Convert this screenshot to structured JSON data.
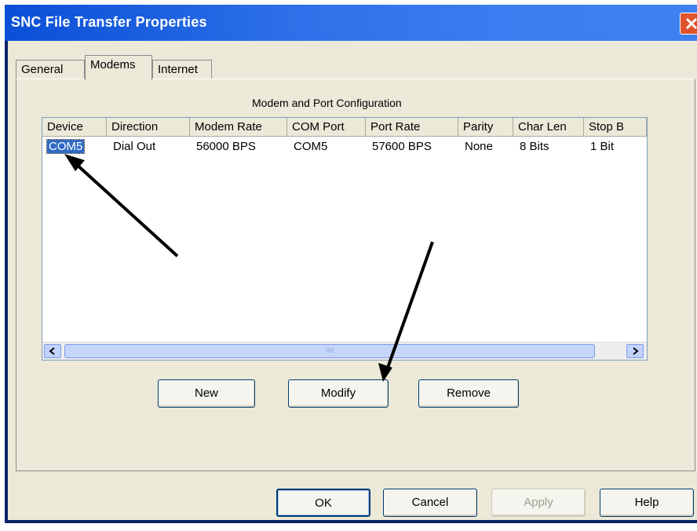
{
  "window": {
    "title": "SNC File Transfer Properties"
  },
  "tabs": [
    {
      "label": "General",
      "active": false
    },
    {
      "label": "Modems",
      "active": true
    },
    {
      "label": "Internet",
      "active": false
    }
  ],
  "group": {
    "label": "Modem and Port Configuration"
  },
  "table": {
    "columns": [
      "Device",
      "Direction",
      "Modem Rate",
      "COM Port",
      "Port Rate",
      "Parity",
      "Char Len",
      "Stop B"
    ],
    "rows": [
      {
        "device": "COM5",
        "direction": "Dial Out",
        "modem_rate": "56000 BPS",
        "com_port": "COM5",
        "port_rate": "57600 BPS",
        "parity": "None",
        "char_len": "8 Bits",
        "stop_bits": "1 Bit",
        "selected": true
      }
    ]
  },
  "scrollbar": {
    "thumb_grip": "IIII"
  },
  "buttons": {
    "new": "New",
    "modify": "Modify",
    "remove": "Remove"
  },
  "footer": {
    "ok": "OK",
    "cancel": "Cancel",
    "apply": "Apply",
    "help": "Help"
  },
  "colors": {
    "titlebar": "#0a4fd6",
    "selection": "#316ac5",
    "dialog_bg": "#ece9d8"
  }
}
